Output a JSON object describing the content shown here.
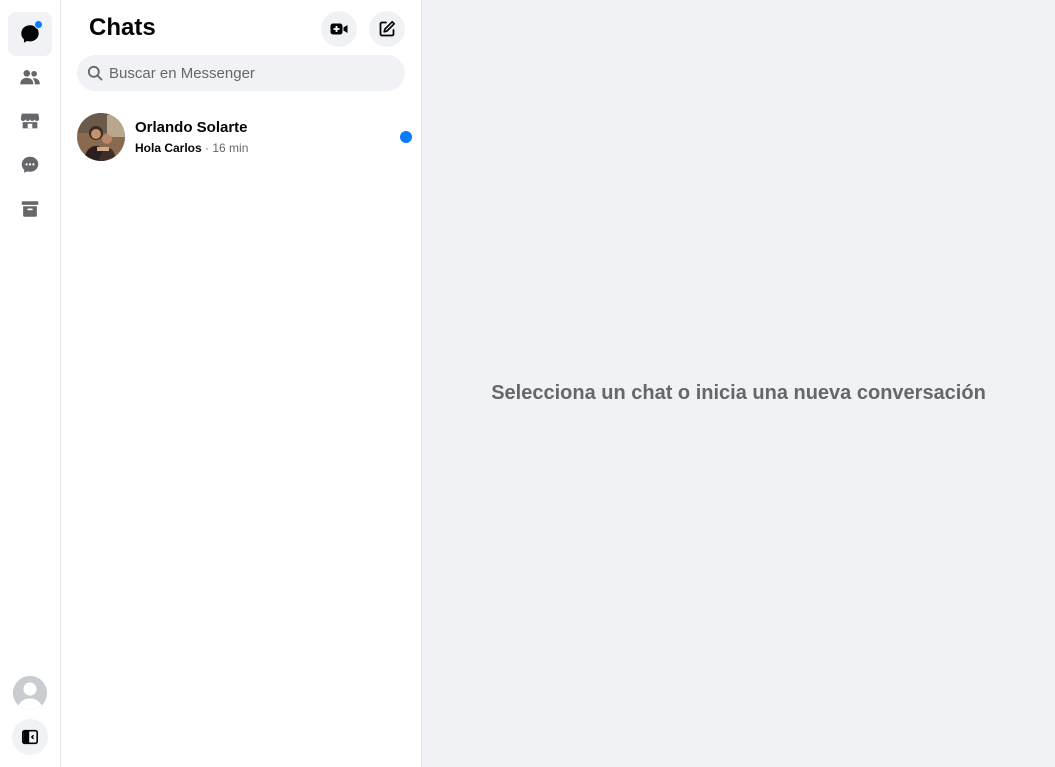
{
  "rail": {
    "items": [
      {
        "icon": "chat-bubble-icon",
        "active": true,
        "has_notification": true
      },
      {
        "icon": "people-icon",
        "active": false
      },
      {
        "icon": "marketplace-store-icon",
        "active": false
      },
      {
        "icon": "message-requests-icon",
        "active": false
      },
      {
        "icon": "archive-icon",
        "active": false
      }
    ],
    "bottom": {
      "avatar": "user-avatar",
      "toggle": "sidebar-toggle-icon"
    }
  },
  "panel": {
    "title": "Chats",
    "actions": [
      {
        "icon": "video-call-icon"
      },
      {
        "icon": "compose-icon"
      }
    ],
    "search": {
      "placeholder": "Buscar en Messenger",
      "value": ""
    }
  },
  "chats": [
    {
      "name": "Orlando Solarte",
      "last_message": "Hola Carlos",
      "separator": " · ",
      "time": "16 min",
      "unread": true
    }
  ],
  "main": {
    "empty_text": "Selecciona un chat o inicia una nueva conversación"
  },
  "colors": {
    "accent": "#0a7cff",
    "background": "#f0f2f5",
    "text": "#050505",
    "secondary_text": "#65676b"
  }
}
